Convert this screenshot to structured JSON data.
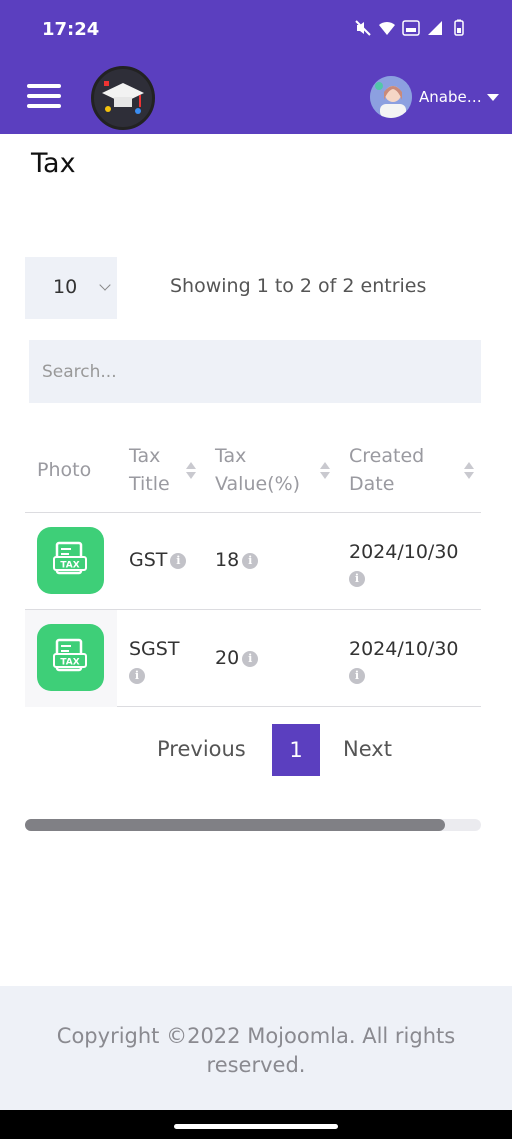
{
  "status_bar": {
    "time": "17:24"
  },
  "app_bar": {
    "user_name": "Anabe…"
  },
  "page": {
    "title": "Tax"
  },
  "table_controls": {
    "page_length": "10",
    "showing_text": "Showing 1 to 2 of 2 entries",
    "search_placeholder": "Search..."
  },
  "table": {
    "headers": [
      {
        "line1": "Photo",
        "line2": ""
      },
      {
        "line1": "Tax",
        "line2": "Title"
      },
      {
        "line1": "Tax",
        "line2": "Value(%)"
      },
      {
        "line1": "Created",
        "line2": "Date"
      }
    ],
    "rows": [
      {
        "photo_icon": "tax-receipt-icon",
        "title": "GST",
        "value": "18",
        "created": "2024/10/30"
      },
      {
        "photo_icon": "tax-receipt-icon",
        "title": "SGST",
        "value": "20",
        "created": "2024/10/30"
      }
    ]
  },
  "pagination": {
    "previous": "Previous",
    "current_page": "1",
    "next": "Next"
  },
  "footer": {
    "copyright": "Copyright ©2022 Mojoomla. All rights reserved."
  },
  "colors": {
    "primary": "#5b3fbf",
    "photo_bg": "#3ecf78",
    "input_bg": "#eef1f7"
  }
}
